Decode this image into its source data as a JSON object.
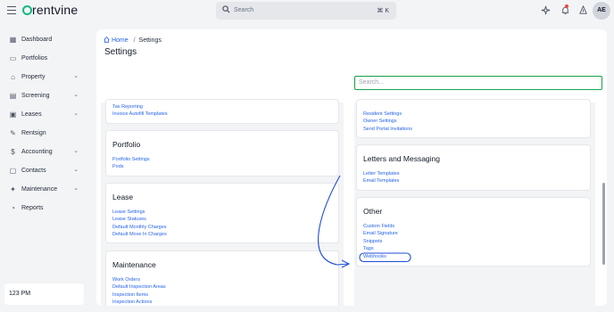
{
  "topbar": {
    "logo": "rentvine",
    "search_placeholder": "Search",
    "search_shortcut": "⌘ K",
    "avatar_initials": "AE",
    "icons": [
      "hamburger-icon",
      "sparkle-icon",
      "bell-icon",
      "user-icon"
    ]
  },
  "sidebar": {
    "items": [
      {
        "label": "Dashboard",
        "icon": "dashboard-icon",
        "expandable": false
      },
      {
        "label": "Portfolios",
        "icon": "portfolio-icon",
        "expandable": false
      },
      {
        "label": "Property",
        "icon": "property-icon",
        "expandable": true
      },
      {
        "label": "Screening",
        "icon": "screening-icon",
        "expandable": true
      },
      {
        "label": "Leases",
        "icon": "lease-icon",
        "expandable": true
      },
      {
        "label": "Rentsign",
        "icon": "rentsign-icon",
        "expandable": false
      },
      {
        "label": "Accounting",
        "icon": "dollar-icon",
        "expandable": true
      },
      {
        "label": "Contacts",
        "icon": "contacts-icon",
        "expandable": true
      },
      {
        "label": "Maintenance",
        "icon": "wrench-icon",
        "expandable": true
      },
      {
        "label": "Reports",
        "icon": "reports-icon",
        "expandable": false
      }
    ],
    "time": "123 PM"
  },
  "main": {
    "breadcrumb": {
      "home": "Home",
      "separator": "/",
      "current": "Settings"
    },
    "title": "Settings",
    "search_placeholder": "Search...",
    "left_column": [
      {
        "title": "",
        "links": [
          "Tax Reporting",
          "Invoice Autofill Templates"
        ]
      },
      {
        "title": "Portfolio",
        "links": [
          "Portfolio Settings",
          "Pods"
        ]
      },
      {
        "title": "Lease",
        "links": [
          "Lease Settings",
          "Lease Statuses",
          "Default Monthly Charges",
          "Default Move In Charges"
        ]
      },
      {
        "title": "Maintenance",
        "links": [
          "Work Orders",
          "Default Inspection Areas",
          "Inspection Items",
          "Inspection Actions"
        ]
      }
    ],
    "right_column": [
      {
        "title": "",
        "links": [
          "Resident Settings",
          "Owner Settings",
          "Send Portal Invitations"
        ]
      },
      {
        "title": "Letters and Messaging",
        "links": [
          "Letter Templates",
          "Email Templates"
        ]
      },
      {
        "title": "Other",
        "links": [
          "Custom Fields",
          "Email Signature",
          "Snippets",
          "Tags",
          "Webhooks"
        ]
      }
    ],
    "highlighted_link": "Webhooks"
  },
  "colors": {
    "link": "#2563eb",
    "search_focus": "#16a34a",
    "annotation": "#1d4ed8",
    "logo_accent": "#10b981"
  }
}
